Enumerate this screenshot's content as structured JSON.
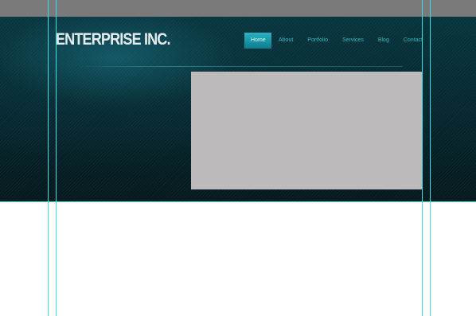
{
  "header": {
    "logo_text": "ENTERPRISE INC."
  },
  "nav": {
    "items": [
      {
        "label": "Home",
        "active": true
      },
      {
        "label": "About",
        "active": false
      },
      {
        "label": "Portfolio",
        "active": false
      },
      {
        "label": "Services",
        "active": false
      },
      {
        "label": "Blog",
        "active": false
      },
      {
        "label": "Contact",
        "active": false
      }
    ]
  },
  "colors": {
    "canvas_gray": "#7a7a7a",
    "header_dark": "#062b33",
    "accent_teal": "#2fb6c0",
    "placeholder_gray": "#bcbaba",
    "guide_cyan": "#33e0e8"
  }
}
